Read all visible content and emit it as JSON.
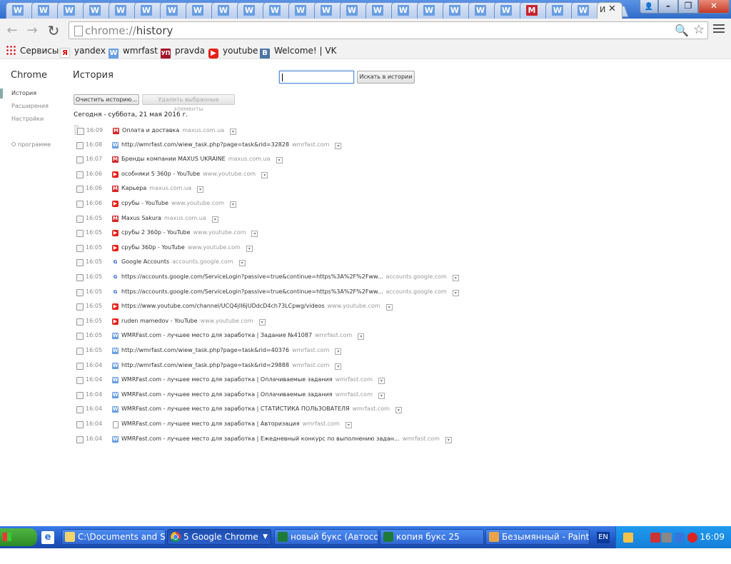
{
  "tabs": {
    "count": 23,
    "favicons": [
      "W",
      "W",
      "W",
      "W",
      "W",
      "W",
      "W",
      "W",
      "W",
      "W",
      "W",
      "W",
      "W",
      "W",
      "W",
      "W",
      "W",
      "W",
      "W",
      "W",
      "M",
      "W",
      "W"
    ],
    "active_title": "И",
    "close_glyph": "✕"
  },
  "window": {
    "minimize": "–",
    "maximize": "❐",
    "close": "✕",
    "profile": "👤"
  },
  "toolbar": {
    "back": "←",
    "forward": "→",
    "reload": "↻",
    "url_scheme": "chrome://",
    "url_path": "history",
    "zoom_icon": "🔍",
    "star_icon": "☆"
  },
  "bookmarks": [
    {
      "label": "Сервисы",
      "icon": "apps"
    },
    {
      "label": "yandex",
      "icon": "Я"
    },
    {
      "label": "wmrfast",
      "icon": "W"
    },
    {
      "label": "pravda",
      "icon": "УП"
    },
    {
      "label": "youtube",
      "icon": "▶"
    },
    {
      "label": "Welcome! | VK",
      "icon": "В"
    }
  ],
  "sidebar": {
    "title": "Chrome",
    "items": [
      "История",
      "Расширения",
      "Настройки",
      "О программе"
    ]
  },
  "history": {
    "title": "История",
    "search_button": "Искать в истории",
    "clear_button": "Очистить историю...",
    "delete_button": "Удалить выбранные элементы",
    "day_heading": "Сегодня - суббота, 21 мая 2016 г.",
    "entries": [
      {
        "time": "16:09",
        "favicon": "maxus",
        "title": "Оплата и доставка",
        "domain": "maxus.com.ua"
      },
      {
        "time": "16:08",
        "favicon": "wmr",
        "title": "http://wmrfast.com/wiew_task.php?page=task&rid=32828",
        "domain": "wmrfast.com"
      },
      {
        "time": "16:07",
        "favicon": "maxus",
        "title": "Бренды компании MAXUS UKRAINE",
        "domain": "maxus.com.ua"
      },
      {
        "time": "16:06",
        "favicon": "yt",
        "title": "особняки 5 360р - YouTube",
        "domain": "www.youtube.com"
      },
      {
        "time": "16:06",
        "favicon": "maxus",
        "title": "Карьера",
        "domain": "maxus.com.ua"
      },
      {
        "time": "16:06",
        "favicon": "yt",
        "title": "срубы - YouTube",
        "domain": "www.youtube.com"
      },
      {
        "time": "16:05",
        "favicon": "maxus",
        "title": "Maxus Sakura",
        "domain": "maxus.com.ua"
      },
      {
        "time": "16:05",
        "favicon": "yt",
        "title": "срубы 2 360р - YouTube",
        "domain": "www.youtube.com"
      },
      {
        "time": "16:05",
        "favicon": "yt",
        "title": "срубы 360р - YouTube",
        "domain": "www.youtube.com"
      },
      {
        "time": "16:05",
        "favicon": "goog",
        "title": "Google Accounts",
        "domain": "accounts.google.com"
      },
      {
        "time": "16:05",
        "favicon": "goog",
        "title": "https://accounts.google.com/ServiceLogin?passive=true&continue=https%3A%2F%2Fww...",
        "domain": "accounts.google.com"
      },
      {
        "time": "16:05",
        "favicon": "goog",
        "title": "https://accounts.google.com/ServiceLogin?passive=true&continue=https%3A%2F%2Fww...",
        "domain": "accounts.google.com"
      },
      {
        "time": "16:05",
        "favicon": "yt",
        "title": "https://www.youtube.com/channel/UCQ4jII6jUDdcD4ch73LCpwg/videos",
        "domain": "www.youtube.com"
      },
      {
        "time": "16:05",
        "favicon": "yt",
        "title": "ruden mamedov - YouTube",
        "domain": "www.youtube.com"
      },
      {
        "time": "16:05",
        "favicon": "wmr",
        "title": "WMRFast.com - лучшее место для заработка | Задание №41087",
        "domain": "wmrfast.com"
      },
      {
        "time": "16:05",
        "favicon": "wmr",
        "title": "http://wmrfast.com/wiew_task.php?page=task&rid=40376",
        "domain": "wmrfast.com"
      },
      {
        "time": "16:04",
        "favicon": "wmr",
        "title": "http://wmrfast.com/wiew_task.php?page=task&rid=29888",
        "domain": "wmrfast.com"
      },
      {
        "time": "16:04",
        "favicon": "wmr",
        "title": "WMRFast.com - лучшее место для заработка | Оплачиваемые задания",
        "domain": "wmrfast.com"
      },
      {
        "time": "16:04",
        "favicon": "wmr",
        "title": "WMRFast.com - лучшее место для заработка | Оплачиваемые задания",
        "domain": "wmrfast.com"
      },
      {
        "time": "16:04",
        "favicon": "wmr",
        "title": "WMRFast.com - лучшее место для заработка | СТАТИСТИКА ПОЛЬЗОВАТЕЛЯ",
        "domain": "wmrfast.com"
      },
      {
        "time": "16:04",
        "favicon": "page",
        "title": "WMRFast.com - лучшее место для заработка | Авторизация",
        "domain": "wmrfast.com"
      },
      {
        "time": "16:04",
        "favicon": "wmr",
        "title": "WMRFast.com - лучшее место для заработка | Ежедневный конкурс по выполнению задан...",
        "domain": "wmrfast.com"
      }
    ]
  },
  "taskbar": {
    "start": "Пуск",
    "tasks": [
      {
        "label": "C:\\Documents and Se...",
        "icon": "folder"
      },
      {
        "label": "5 Google Chrome",
        "icon": "chrome",
        "active": true
      },
      {
        "label": "новый букс (Автосо...",
        "icon": "excel"
      },
      {
        "label": "копия букс 25",
        "icon": "excel"
      },
      {
        "label": "Безымянный - Paint",
        "icon": "paint"
      }
    ],
    "lang": "EN",
    "clock": "16:09"
  },
  "colors": {
    "tabstrip": "#2f6cc9",
    "taskbar": "#2058c6",
    "start": "#3a9a30"
  }
}
